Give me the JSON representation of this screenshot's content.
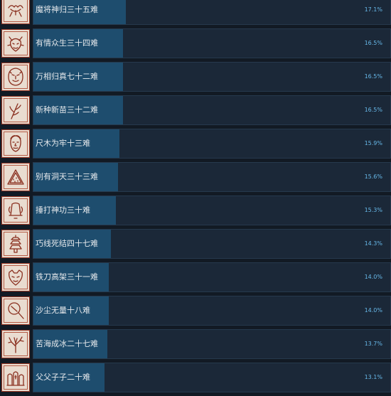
{
  "achievements": [
    {
      "name": "魔将神归三十五难",
      "percent": "17.1%",
      "value": 17.1,
      "icon": "creature-sketch-icon"
    },
    {
      "name": "有情众生三十四难",
      "percent": "16.5%",
      "value": 16.5,
      "icon": "dragon-face-icon"
    },
    {
      "name": "万相归真七十二难",
      "percent": "16.5%",
      "value": 16.5,
      "icon": "lion-face-icon"
    },
    {
      "name": "新种新苗三十二难",
      "percent": "16.5%",
      "value": 16.5,
      "icon": "sprout-branch-icon"
    },
    {
      "name": "尺木为牢十三难",
      "percent": "15.9%",
      "value": 15.9,
      "icon": "face-portrait-icon"
    },
    {
      "name": "别有洞天三十三难",
      "percent": "15.6%",
      "value": 15.6,
      "icon": "watermelon-slice-icon"
    },
    {
      "name": "捶打神功三十难",
      "percent": "15.3%",
      "value": 15.3,
      "icon": "bell-shape-icon"
    },
    {
      "name": "巧线死结四十七难",
      "percent": "14.3%",
      "value": 14.3,
      "icon": "pagoda-tower-icon"
    },
    {
      "name": "铁刀高架三十一难",
      "percent": "14.0%",
      "value": 14.0,
      "icon": "beast-face-icon"
    },
    {
      "name": "沙尘无量十八难",
      "percent": "14.0%",
      "value": 14.0,
      "icon": "magnifier-icon"
    },
    {
      "name": "苦海成冰二十七难",
      "percent": "13.7%",
      "value": 13.7,
      "icon": "bare-tree-icon"
    },
    {
      "name": "父父子子二十难",
      "percent": "13.1%",
      "value": 13.1,
      "icon": "tombstones-icon"
    }
  ],
  "colors": {
    "background": "#121a24",
    "bar_track": "#1b2838",
    "bar_fill": "#1e4d6e",
    "percent_text": "#67b8e8",
    "icon_border": "#9a3a28",
    "icon_bg": "#e9dcd0"
  }
}
